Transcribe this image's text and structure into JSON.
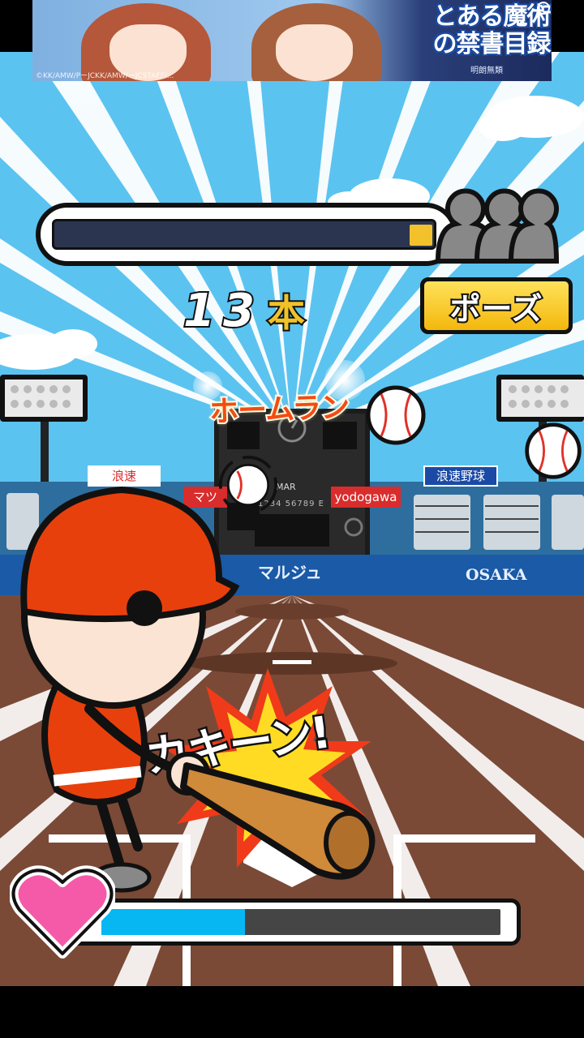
{
  "ad_banner": {
    "title": "とある魔術の禁書目録",
    "subtitle": "明朗無類",
    "copyright": "©KK/AMW/PーJCKK/AMW/ーJCSTAFF/..."
  },
  "hud": {
    "homerun_count": "13",
    "homerun_unit": "本",
    "pause_label": "ポーズ",
    "progress_fraction": 0.06,
    "life_fraction": 0.36
  },
  "effects": {
    "homerun_text": "ホームラン",
    "hit_text": "カキーン!"
  },
  "stadium": {
    "scoreboard_month": "MAR",
    "scoreboard_digits": "1234 56789 E",
    "sign_left": "マツ",
    "sign_right": "yodogawa",
    "sign_left_top": "浪速",
    "sign_right_top": "浪速野球",
    "wall_center": "マルジュ",
    "wall_right": "OSAKA"
  },
  "colors": {
    "sky": "#5bc3f0",
    "player_red": "#e8400c",
    "pause_yellow": "#f3b70d",
    "life_blue": "#06b7f2",
    "heart_pink": "#f45aa8"
  }
}
